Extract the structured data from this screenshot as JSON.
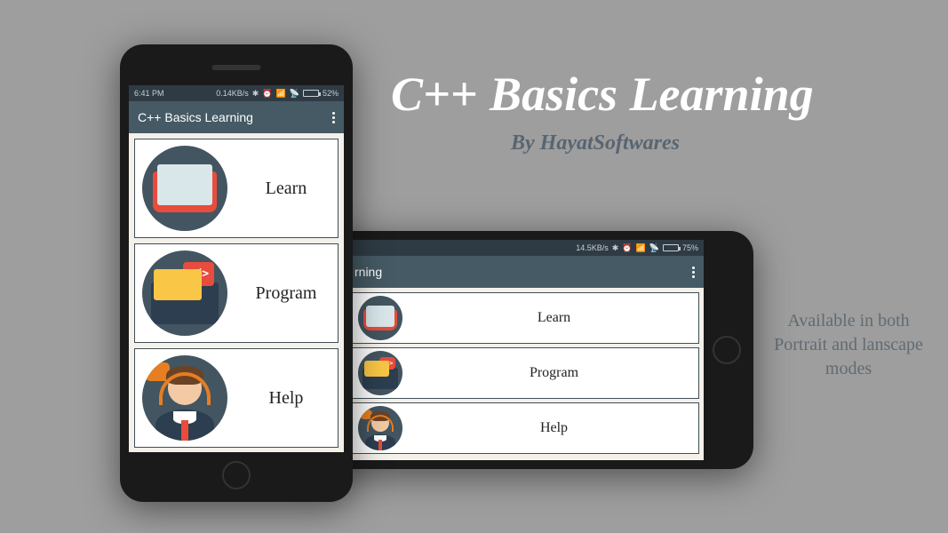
{
  "hero": {
    "title": "C++ Basics Learning",
    "subtitle": "By HayatSoftwares",
    "sideNote": "Available in both Portrait and lanscape modes"
  },
  "portrait": {
    "status": {
      "time": "6:41 PM",
      "data": "0.14KB/s",
      "battery": "52%"
    },
    "appTitle": "C++ Basics Learning",
    "items": [
      {
        "label": "Learn"
      },
      {
        "label": "Program"
      },
      {
        "label": "Help"
      }
    ]
  },
  "landscape": {
    "status": {
      "data": "14.5KB/s",
      "battery": "75%"
    },
    "appTitle": "rning",
    "items": [
      {
        "label": "Learn"
      },
      {
        "label": "Program"
      },
      {
        "label": "Help"
      }
    ]
  }
}
